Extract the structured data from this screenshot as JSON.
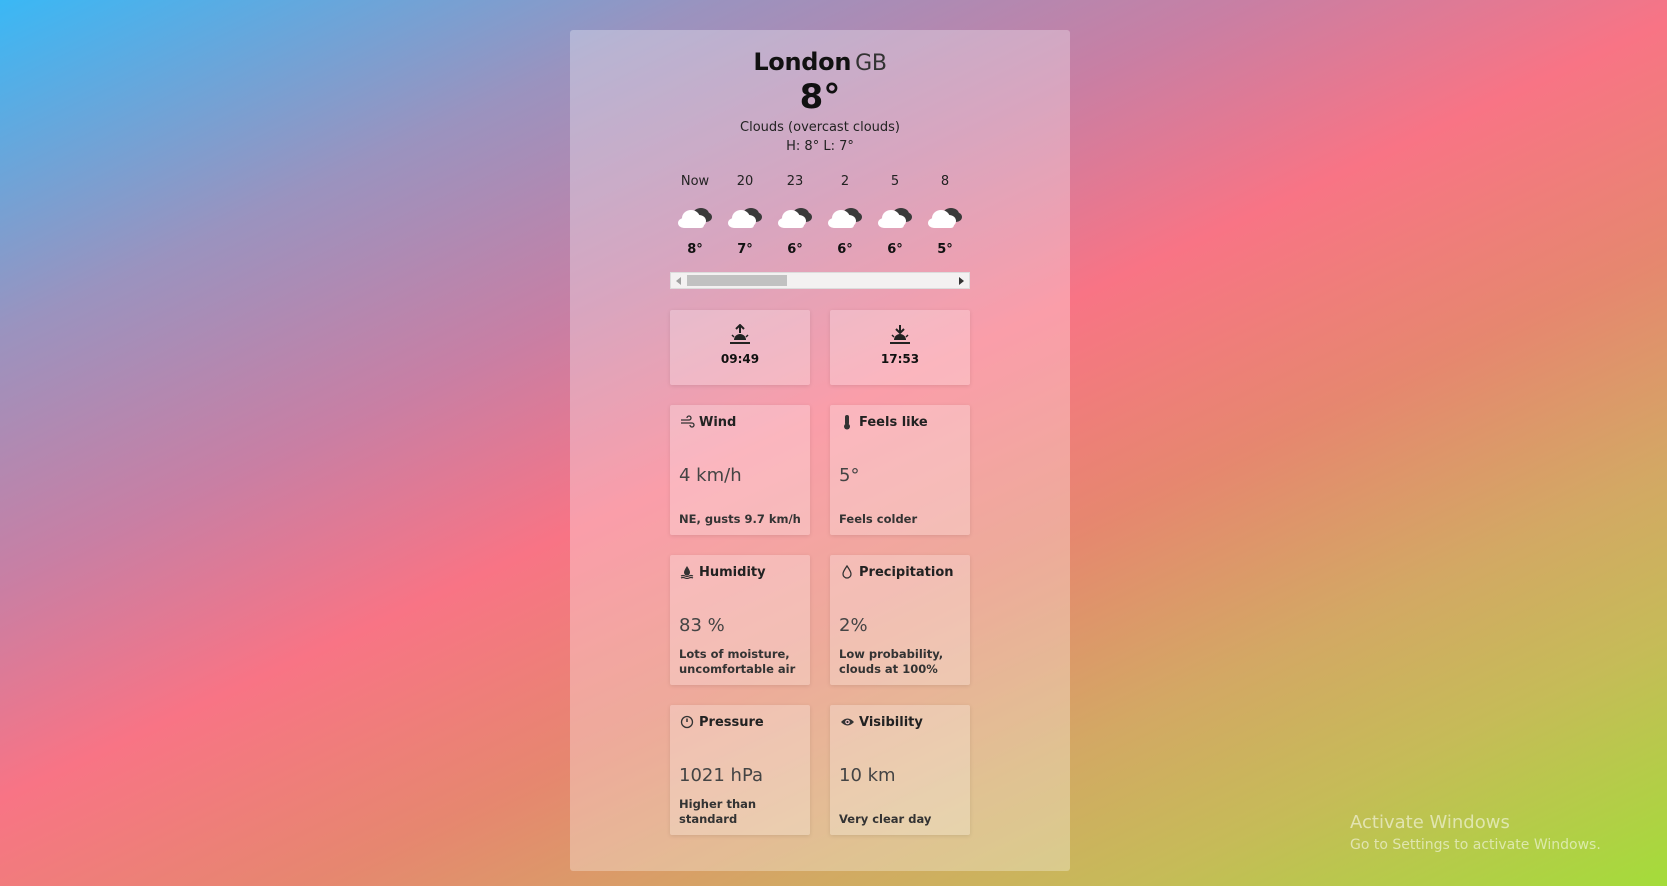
{
  "location": {
    "city": "London",
    "country": "GB"
  },
  "current": {
    "temperature": "8°",
    "description": "Clouds (overcast clouds)",
    "high_low": "H: 8° L: 7°"
  },
  "hourly": [
    {
      "time": "Now",
      "temp": "8°",
      "icon": "cloudy-icon"
    },
    {
      "time": "20",
      "temp": "7°",
      "icon": "cloudy-icon"
    },
    {
      "time": "23",
      "temp": "6°",
      "icon": "cloudy-icon"
    },
    {
      "time": "2",
      "temp": "6°",
      "icon": "cloudy-icon"
    },
    {
      "time": "5",
      "temp": "6°",
      "icon": "cloudy-icon"
    },
    {
      "time": "8",
      "temp": "5°",
      "icon": "cloudy-icon"
    }
  ],
  "sun": {
    "sunrise": "09:49",
    "sunset": "17:53"
  },
  "details": {
    "wind": {
      "title": "Wind",
      "value": "4 km/h",
      "note": "NE, gusts 9.7 km/h"
    },
    "feels_like": {
      "title": "Feels like",
      "value": "5°",
      "note": "Feels colder"
    },
    "humidity": {
      "title": "Humidity",
      "value": "83 %",
      "note": "Lots of moisture, uncomfortable air"
    },
    "precipitation": {
      "title": "Precipitation",
      "value": "2%",
      "note": "Low probability, clouds at 100%"
    },
    "pressure": {
      "title": "Pressure",
      "value": "1021 hPa",
      "note": "Higher than standard"
    },
    "visibility": {
      "title": "Visibility",
      "value": "10 km",
      "note": "Very clear day"
    }
  },
  "watermark": {
    "line1": "Activate Windows",
    "line2": "Go to Settings to activate Windows."
  }
}
